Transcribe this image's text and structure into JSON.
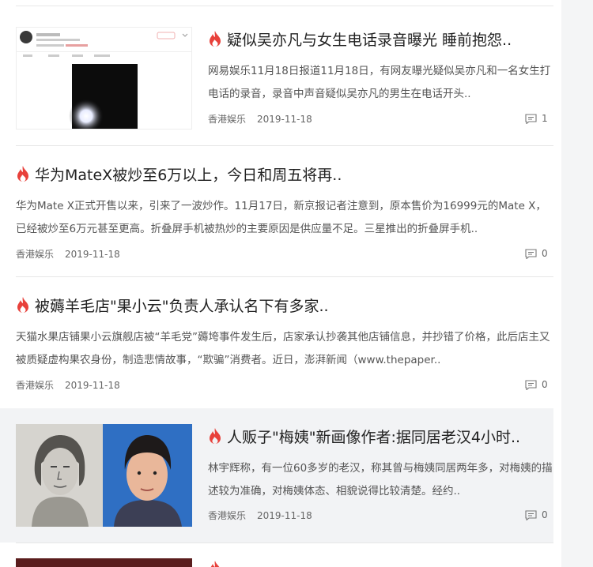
{
  "colors": {
    "accent_fire": "#e8413b",
    "highlight_bg": "#f2f3f5"
  },
  "icons": {
    "hot": "fire-icon",
    "comment": "comment-icon"
  },
  "articles": [
    {
      "title": "疑似吴亦凡与女生电话录音曝光 睡前抱怨..",
      "summary": "网易娱乐11月18日报道11月18日，有网友曝光疑似吴亦凡和一名女生打电话的录音，录音中声音疑似吴亦凡的男生在电话开头..",
      "source": "香港娱乐",
      "date": "2019-11-18",
      "comments": "1"
    },
    {
      "title": "华为MateX被炒至6万以上，今日和周五将再..",
      "summary": "华为Mate X正式开售以来，引来了一波炒作。11月17日，新京报记者注意到，原本售价为16999元的Mate X，已经被炒至6万元甚至更高。折叠屏手机被热炒的主要原因是供应量不足。三星推出的折叠屏手机..",
      "source": "香港娱乐",
      "date": "2019-11-18",
      "comments": "0"
    },
    {
      "title": "被薅羊毛店\"果小云\"负责人承认名下有多家..",
      "summary": "天猫水果店铺果小云旗舰店被“羊毛党”薅垮事件发生后，店家承认抄袭其他店铺信息，并抄错了价格，此后店主又被质疑虚构果农身份，制造悲情故事，“欺骗”消费者。近日，澎湃新闻（www.thepaper..",
      "source": "香港娱乐",
      "date": "2019-11-18",
      "comments": "0"
    },
    {
      "title": "人贩子\"梅姨\"新画像作者:据同居老汉4小时..",
      "summary": "林宇辉称，有一位60多岁的老汉，称其曾与梅姨同居两年多，对梅姨的描述较为准确，对梅姨体态、相貌说得比较清楚。经约..",
      "source": "香港娱乐",
      "date": "2019-11-18",
      "comments": "0"
    }
  ]
}
